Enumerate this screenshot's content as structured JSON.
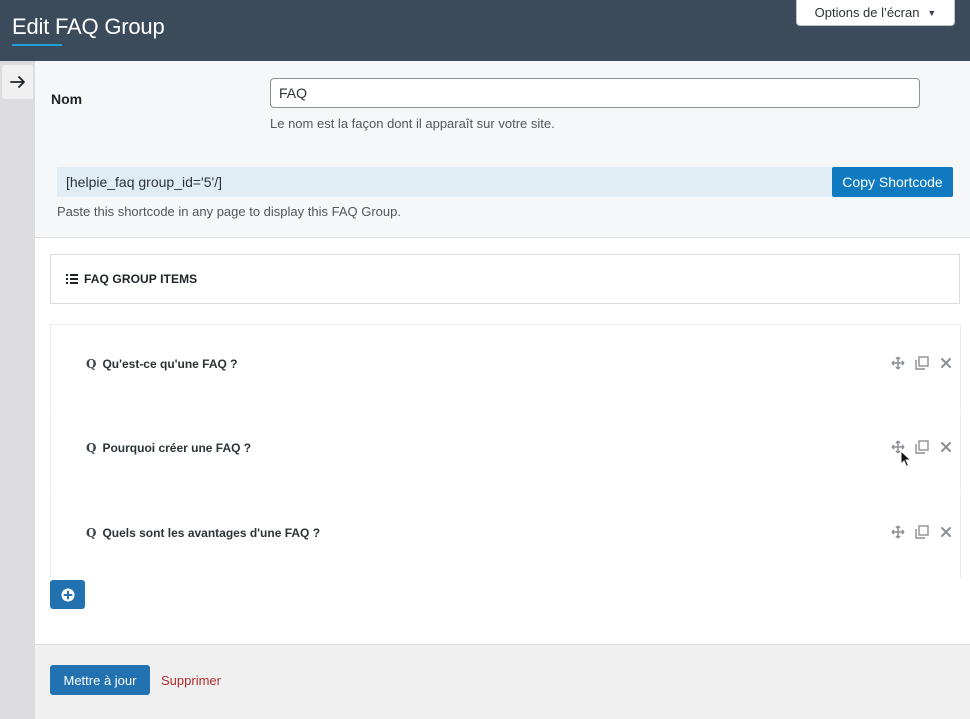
{
  "header": {
    "title": "Edit FAQ Group",
    "screen_options_label": "Options de l’écran"
  },
  "form": {
    "name_label": "Nom",
    "name_value": "FAQ",
    "name_help": "Le nom est la façon dont il apparaît sur votre site.",
    "shortcode": "[helpie_faq group_id='5'/]",
    "copy_label": "Copy Shortcode",
    "shortcode_help": "Paste this shortcode in any page to display this FAQ Group."
  },
  "group_items": {
    "title": "FAQ GROUP ITEMS",
    "items": [
      {
        "question": "Qu'est-ce qu'une FAQ ?"
      },
      {
        "question": "Pourquoi créer une FAQ ?"
      },
      {
        "question": "Quels sont les avantages d'une FAQ ?"
      }
    ]
  },
  "footer": {
    "update_label": "Mettre à jour",
    "delete_label": "Supprimer"
  },
  "icons": {
    "collapse": "arrow-right-icon",
    "list": "list-icon",
    "question": "question-icon",
    "move": "move-icon",
    "duplicate": "duplicate-icon",
    "remove": "close-icon",
    "add": "plus-circle-icon"
  },
  "colors": {
    "topbar": "#3c4b5c",
    "accent": "#2271b1",
    "copy_button": "#0f7abf",
    "danger": "#b32d2e",
    "title_underline": "#1e9fd8"
  }
}
